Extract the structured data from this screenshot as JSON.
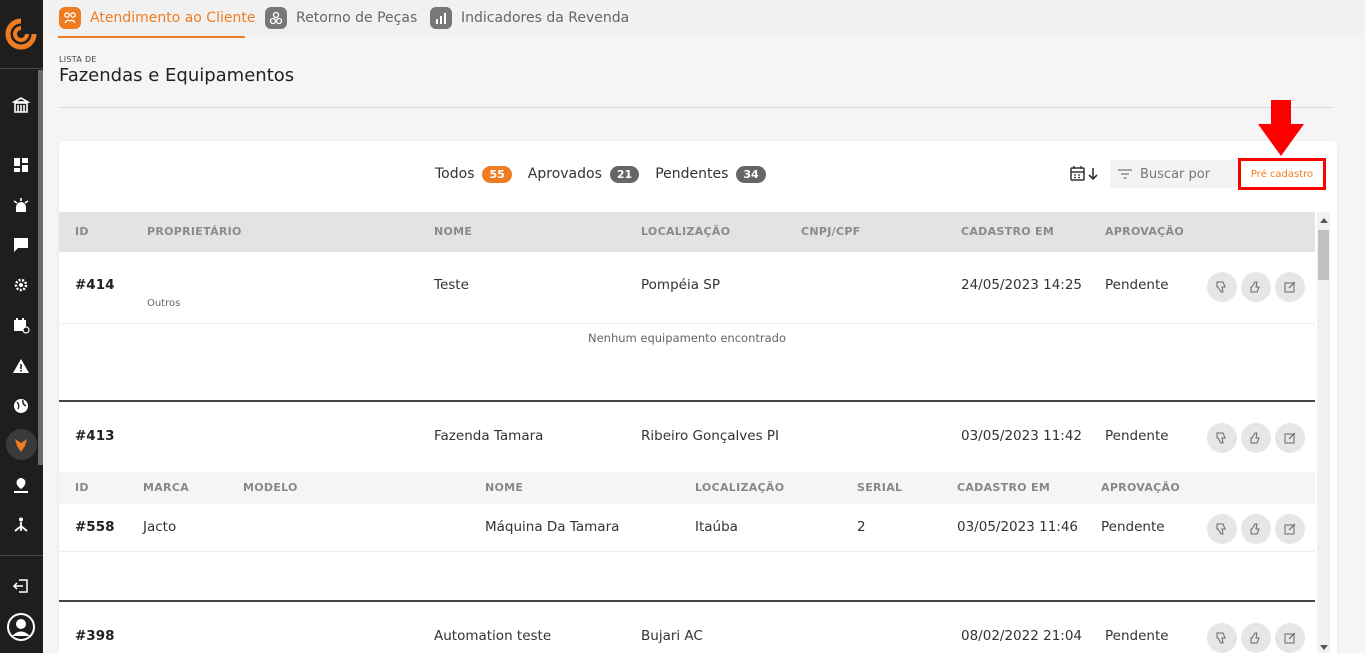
{
  "tabs": [
    {
      "label": "Atendimento ao Cliente",
      "icon": "customer-service-icon",
      "active": true
    },
    {
      "label": "Retorno de Peças",
      "icon": "parts-return-icon",
      "active": false
    },
    {
      "label": "Indicadores da Revenda",
      "icon": "bar-chart-icon",
      "active": false
    }
  ],
  "page": {
    "subtitle": "LISTA DE",
    "title": "Fazendas e Equipamentos"
  },
  "filters": [
    {
      "label": "Todos",
      "count": "55"
    },
    {
      "label": "Aprovados",
      "count": "21"
    },
    {
      "label": "Pendentes",
      "count": "34"
    }
  ],
  "search": {
    "placeholder": "Buscar por"
  },
  "pre_cadastro_label": "Pré cadastro",
  "table": {
    "headers": [
      "ID",
      "PROPRIETÁRIO",
      "NOME",
      "LOCALIZAÇÃO",
      "CNPJ/CPF",
      "CADASTRO EM",
      "APROVAÇÃO"
    ],
    "rows": [
      {
        "id": "#414",
        "owner": "",
        "owner_sub": "Outros",
        "name": "Teste",
        "location": "Pompéia SP",
        "doc": "",
        "date": "24/05/2023 14:25",
        "status": "Pendente",
        "empty_msg": "Nenhum equipamento encontrado"
      },
      {
        "id": "#413",
        "owner": "",
        "owner_sub": "",
        "name": "Fazenda Tamara",
        "location": "Ribeiro Gonçalves PI",
        "doc": "",
        "date": "03/05/2023 11:42",
        "status": "Pendente"
      },
      {
        "id": "#398",
        "owner": "",
        "owner_sub": "",
        "name": "Automation teste",
        "location": "Bujari AC",
        "doc": "",
        "date": "08/02/2022 21:04",
        "status": "Pendente"
      }
    ]
  },
  "equipment": {
    "headers": [
      "ID",
      "MARCA",
      "MODELO",
      "NOME",
      "LOCALIZAÇÃO",
      "SERIAL",
      "CADASTRO EM",
      "APROVAÇÃO"
    ],
    "rows": [
      {
        "id": "#558",
        "brand": "Jacto",
        "model": "",
        "name": "Máquina Da Tamara",
        "location": "Itaúba",
        "serial": "2",
        "date": "03/05/2023 11:46",
        "status": "Pendente"
      }
    ]
  },
  "colors": {
    "accent": "#f07c22",
    "sidebar": "#1e1e1e",
    "highlight": "#ff0000"
  }
}
